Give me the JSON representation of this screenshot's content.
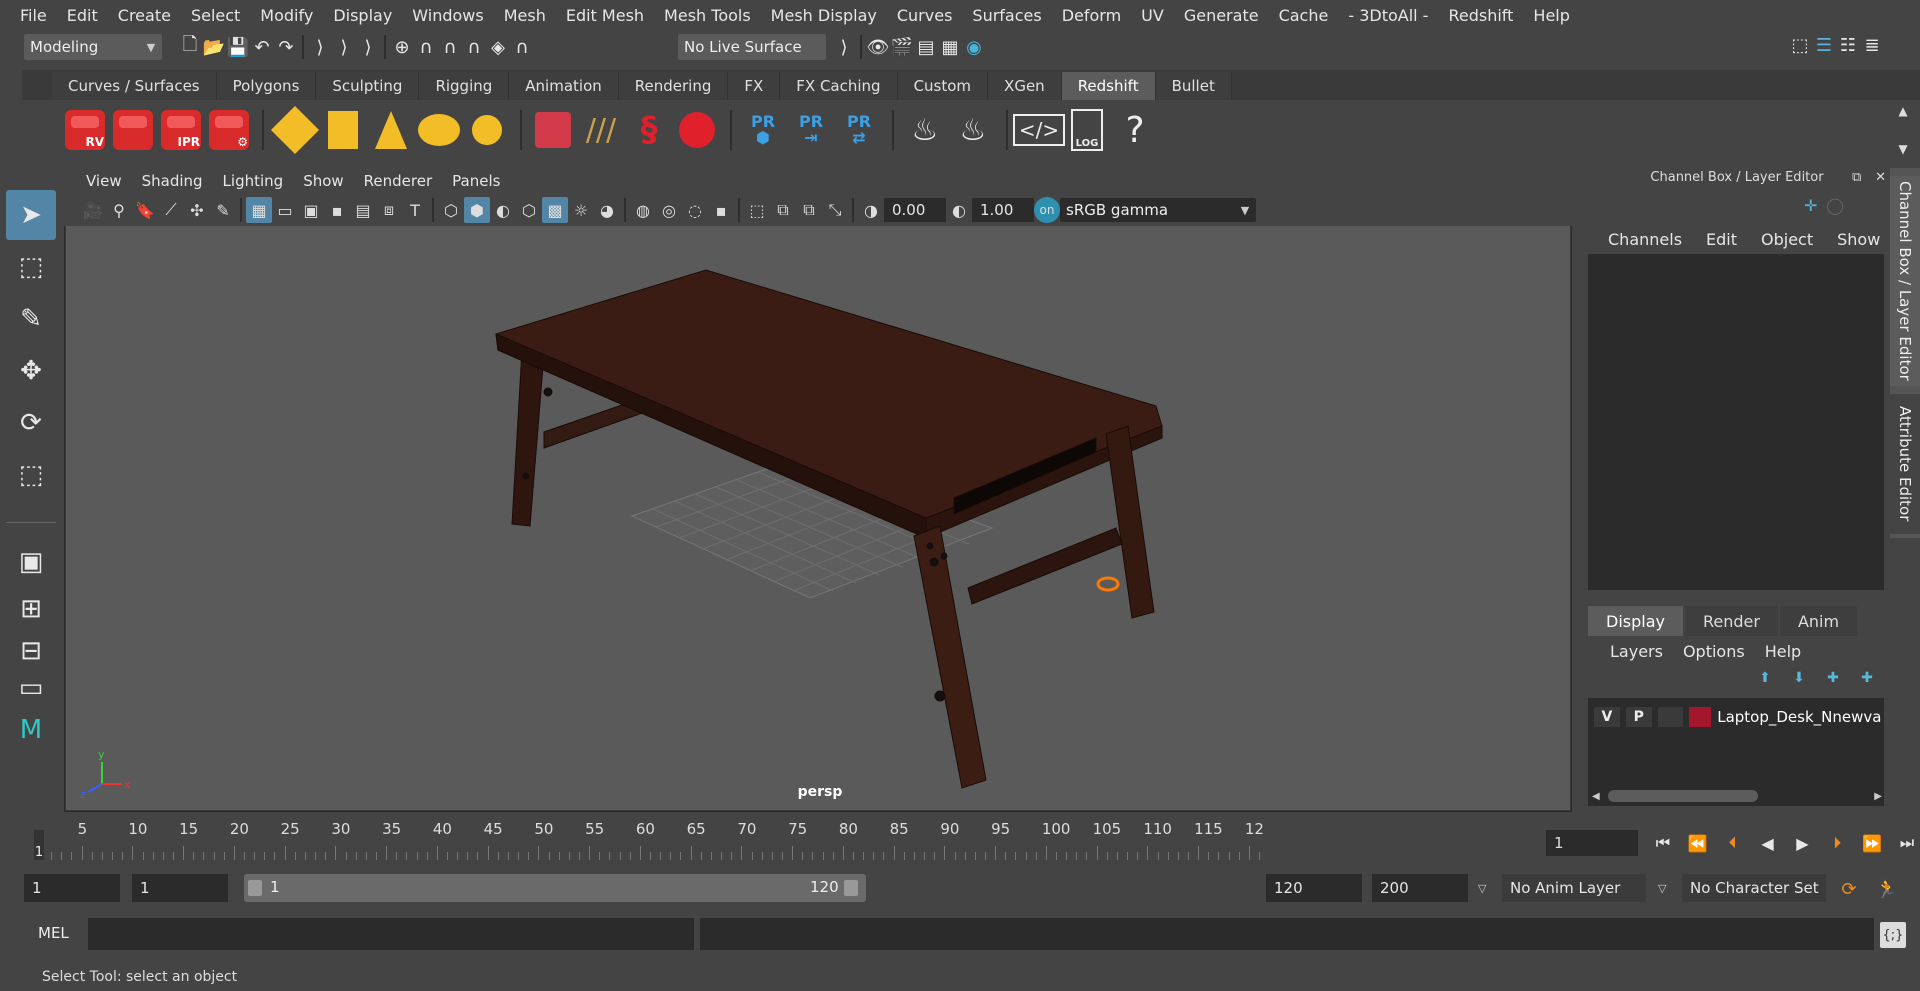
{
  "menubar": {
    "items": [
      "File",
      "Edit",
      "Create",
      "Select",
      "Modify",
      "Display",
      "Windows",
      "Mesh",
      "Edit Mesh",
      "Mesh Tools",
      "Mesh Display",
      "Curves",
      "Surfaces",
      "Deform",
      "UV",
      "Generate",
      "Cache",
      "- 3DtoAll -",
      "Redshift",
      "Help"
    ]
  },
  "statusline": {
    "mode": "Modeling",
    "live_surface": "No Live Surface"
  },
  "shelf": {
    "tabs": [
      "Curves / Surfaces",
      "Polygons",
      "Sculpting",
      "Rigging",
      "Animation",
      "Rendering",
      "FX",
      "FX Caching",
      "Custom",
      "XGen",
      "Redshift",
      "Bullet"
    ],
    "active_tab": "Redshift",
    "rv_label": "RV",
    "ipr_label": "IPR",
    "pr_label": "PR",
    "log_label": "LOG",
    "help_glyph": "?"
  },
  "viewport": {
    "menus": [
      "View",
      "Shading",
      "Lighting",
      "Show",
      "Renderer",
      "Panels"
    ],
    "exposure": "0.00",
    "gamma": "1.00",
    "color_space": "sRGB gamma",
    "camera": "persp",
    "axis_x": "x",
    "axis_y": "y",
    "axis_z": "z"
  },
  "channel_box": {
    "title": "Channel Box / Layer Editor",
    "menus": [
      "Channels",
      "Edit",
      "Object",
      "Show"
    ]
  },
  "layer_editor": {
    "tabs": [
      "Display",
      "Render",
      "Anim"
    ],
    "active_tab": "Display",
    "menus": [
      "Layers",
      "Options",
      "Help"
    ],
    "layer": {
      "v": "V",
      "p": "P",
      "name": "Laptop_Desk_Nnewvar",
      "color": "#a3162c"
    }
  },
  "side_tabs": [
    "Channel Box / Layer Editor",
    "Attribute Editor"
  ],
  "timeline": {
    "ticks": [
      "5",
      "10",
      "15",
      "20",
      "25",
      "30",
      "35",
      "40",
      "45",
      "50",
      "55",
      "60",
      "65",
      "70",
      "75",
      "80",
      "85",
      "90",
      "95",
      "100",
      "105",
      "110",
      "115",
      "12"
    ],
    "current_marker": "1",
    "current_frame": "1"
  },
  "range": {
    "start": "1",
    "playback_start": "1",
    "slider_start": "1",
    "slider_end": "120",
    "playback_end": "120",
    "end": "200",
    "anim_layer": "No Anim Layer",
    "character_set": "No Character Set"
  },
  "command_line": {
    "label": "MEL"
  },
  "status": {
    "message": "Select Tool: select an object"
  }
}
